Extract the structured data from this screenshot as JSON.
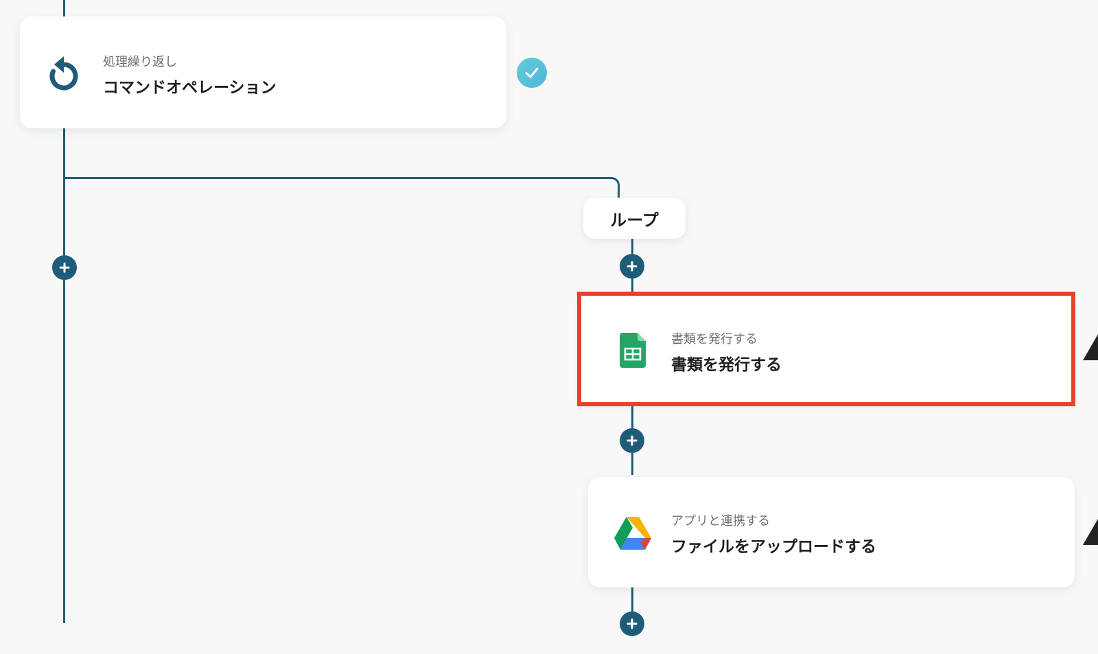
{
  "flow": {
    "command_card": {
      "subtitle": "処理繰り返し",
      "title": "コマンドオペレーション",
      "icon": "loop-arrow-icon",
      "status_icon": "check-icon"
    },
    "loop_label": "ループ",
    "sheets_card": {
      "subtitle": "書類を発行する",
      "title": "書類を発行する",
      "icon": "google-sheets-icon"
    },
    "drive_card": {
      "subtitle": "アプリと連携する",
      "title": "ファイルをアップロードする",
      "icon": "google-drive-icon"
    },
    "add_button_icon": "plus-icon"
  },
  "colors": {
    "connector": "#1f5c7a",
    "highlight": "#e8412c",
    "check_badge": "#56c0da",
    "sheets_green": "#23a566",
    "background": "#f8f8f8"
  }
}
